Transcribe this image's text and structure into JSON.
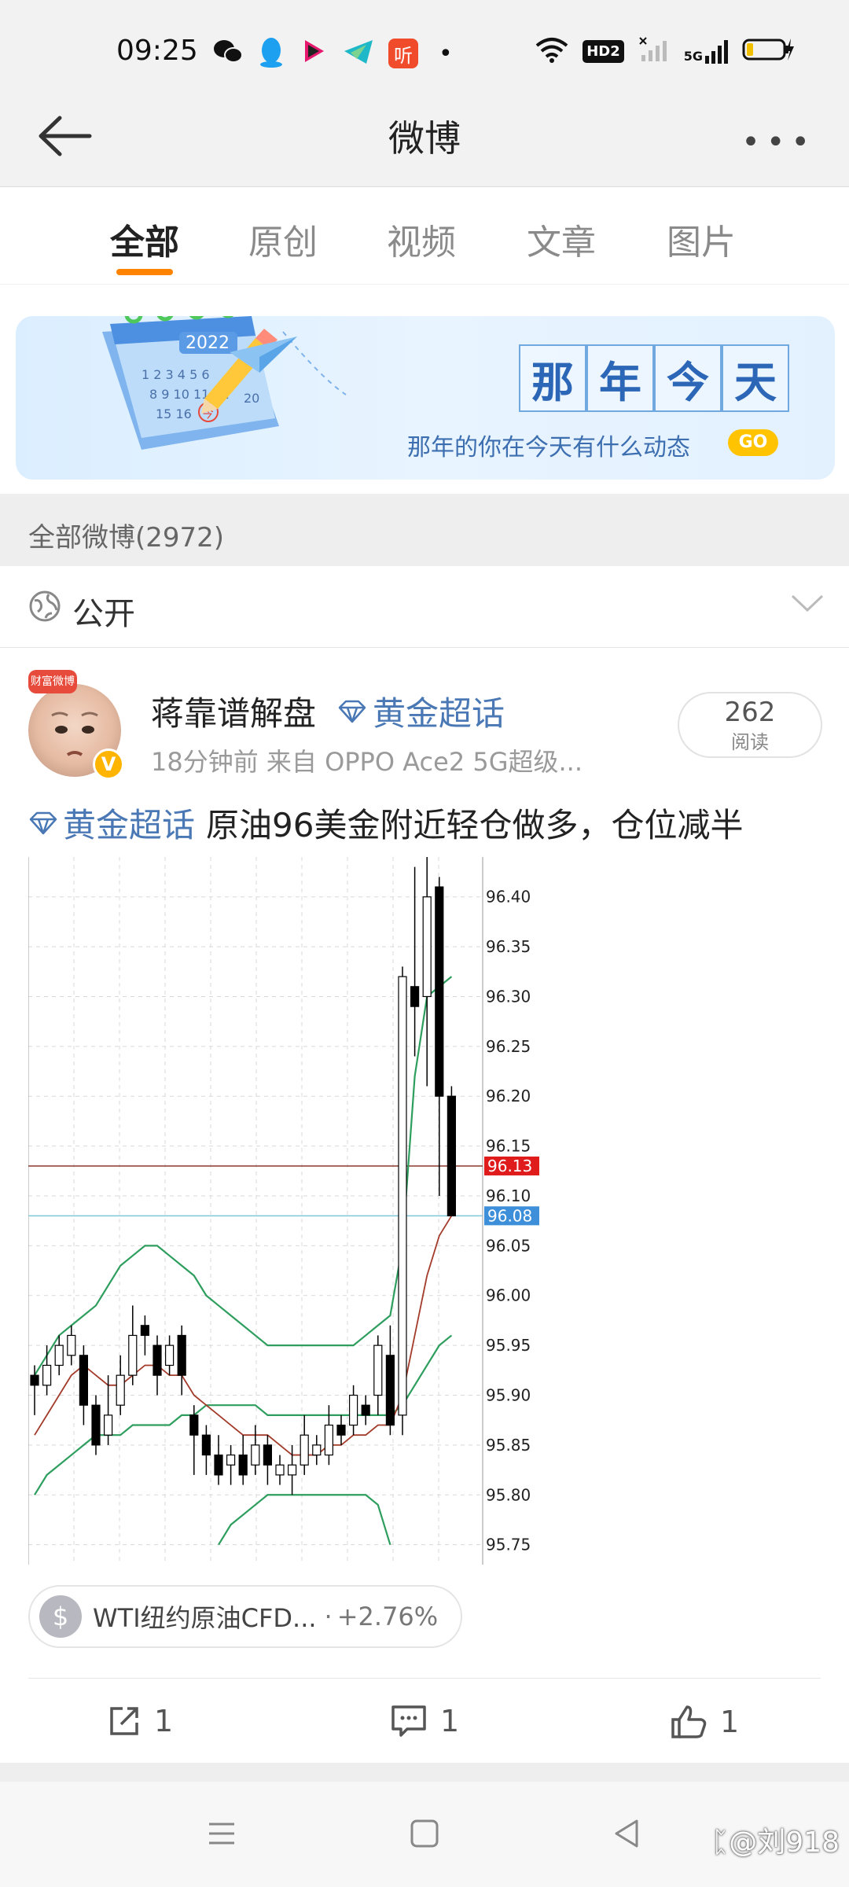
{
  "status_bar": {
    "time": "09:25",
    "app_icons": [
      "wechat-icon",
      "qq-icon",
      "tiktok-like-icon",
      "telegram-like-icon",
      "ting-icon"
    ],
    "ting_label": "听",
    "hd_label": "HD2",
    "network_label": "5G",
    "colors": {
      "qq": "#1ea0f0",
      "ting": "#f04b2b"
    }
  },
  "header": {
    "title": "微博",
    "back_icon": "back-arrow-icon",
    "more_icon": "more-dots-icon"
  },
  "tabs": [
    {
      "label": "全部",
      "active": true
    },
    {
      "label": "原创",
      "active": false
    },
    {
      "label": "视频",
      "active": false
    },
    {
      "label": "文章",
      "active": false
    },
    {
      "label": "图片",
      "active": false
    }
  ],
  "banner": {
    "calendar_year": "2022",
    "calendar_day_mark": "今",
    "chars": [
      "那",
      "年",
      "今",
      "天"
    ],
    "subtitle": "那年的你在今天有什么动态",
    "go_label": "GO"
  },
  "section": {
    "label": "全部微博(2972)"
  },
  "filter": {
    "label": "公开",
    "icon": "globe-icon"
  },
  "post": {
    "user_name": "蒋靠谱解盘",
    "avatar_badge": "财富微博",
    "verified_mark": "V",
    "topic_badge": "黄金超话",
    "meta": "18分钟前   来自 OPPO Ace2 5G超级...",
    "reads_count": "262",
    "reads_label": "阅读",
    "hash_topic": "黄金超话",
    "text": "原油96美金附近轻仓做多，仓位减半",
    "stock": {
      "name": "WTI纽约原油CFD...",
      "sep": "·",
      "change": "+2.76%",
      "dollar": "$"
    },
    "actions": {
      "repost": "1",
      "comment": "1",
      "like": "1"
    }
  },
  "chart_data": {
    "type": "candlestick",
    "ylim": [
      95.73,
      96.44
    ],
    "y_ticks": [
      "96.40",
      "96.35",
      "96.30",
      "96.25",
      "96.20",
      "96.15",
      "96.10",
      "96.05",
      "96.00",
      "95.95",
      "95.90",
      "95.85",
      "95.80",
      "95.75"
    ],
    "price_tags": [
      {
        "value": 96.13,
        "label": "96.13",
        "color": "#e01b1b",
        "line_color": "#8b3a2a"
      },
      {
        "value": 96.08,
        "label": "96.08",
        "color": "#3c8fd8",
        "line_color": "#7ec8d8"
      }
    ],
    "candles": [
      [
        95.92,
        95.91,
        95.93,
        95.88
      ],
      [
        95.91,
        95.93,
        95.95,
        95.9
      ],
      [
        95.93,
        95.95,
        95.96,
        95.92
      ],
      [
        95.94,
        95.96,
        95.97,
        95.93
      ],
      [
        95.94,
        95.89,
        95.95,
        95.87
      ],
      [
        95.89,
        95.85,
        95.9,
        95.84
      ],
      [
        95.86,
        95.88,
        95.92,
        95.85
      ],
      [
        95.89,
        95.92,
        95.94,
        95.88
      ],
      [
        95.92,
        95.96,
        95.99,
        95.91
      ],
      [
        95.97,
        95.96,
        95.98,
        95.94
      ],
      [
        95.95,
        95.92,
        95.96,
        95.9
      ],
      [
        95.93,
        95.95,
        95.96,
        95.92
      ],
      [
        95.96,
        95.92,
        95.97,
        95.9
      ],
      [
        95.88,
        95.86,
        95.89,
        95.82
      ],
      [
        95.86,
        95.84,
        95.87,
        95.82
      ],
      [
        95.84,
        95.82,
        95.86,
        95.81
      ],
      [
        95.83,
        95.84,
        95.85,
        95.81
      ],
      [
        95.84,
        95.82,
        95.86,
        95.81
      ],
      [
        95.83,
        95.85,
        95.87,
        95.82
      ],
      [
        95.85,
        95.83,
        95.86,
        95.81
      ],
      [
        95.82,
        95.83,
        95.84,
        95.81
      ],
      [
        95.82,
        95.83,
        95.85,
        95.8
      ],
      [
        95.83,
        95.86,
        95.88,
        95.82
      ],
      [
        95.84,
        95.85,
        95.86,
        95.83
      ],
      [
        95.84,
        95.87,
        95.89,
        95.83
      ],
      [
        95.87,
        95.86,
        95.88,
        95.85
      ],
      [
        95.87,
        95.9,
        95.91,
        95.86
      ],
      [
        95.89,
        95.88,
        95.9,
        95.87
      ],
      [
        95.9,
        95.95,
        95.96,
        95.88
      ],
      [
        95.94,
        95.87,
        95.97,
        95.86
      ],
      [
        95.88,
        96.32,
        96.33,
        95.86
      ],
      [
        96.31,
        96.29,
        96.43,
        96.24
      ],
      [
        96.3,
        96.4,
        96.44,
        96.21
      ],
      [
        96.41,
        96.2,
        96.42,
        96.1
      ],
      [
        96.2,
        96.08,
        96.21,
        96.08
      ]
    ],
    "ma_red": [
      95.86,
      95.88,
      95.9,
      95.92,
      95.93,
      95.92,
      95.91,
      95.91,
      95.92,
      95.93,
      95.93,
      95.92,
      95.92,
      95.9,
      95.89,
      95.88,
      95.87,
      95.86,
      95.86,
      95.86,
      95.85,
      95.84,
      95.84,
      95.84,
      95.85,
      95.85,
      95.86,
      95.86,
      95.87,
      95.87,
      95.9,
      95.96,
      96.02,
      96.06,
      96.08
    ],
    "bb_upper": [
      95.92,
      95.94,
      95.96,
      95.97,
      95.98,
      95.99,
      96.01,
      96.03,
      96.04,
      96.05,
      96.05,
      96.04,
      96.03,
      96.02,
      96.0,
      95.99,
      95.98,
      95.97,
      95.96,
      95.95,
      95.95,
      95.95,
      95.95,
      95.95,
      95.95,
      95.95,
      95.95,
      95.96,
      95.97,
      95.98,
      96.05,
      96.22,
      96.3,
      96.31,
      96.32
    ],
    "bb_middle": [
      95.8,
      95.82,
      95.83,
      95.84,
      95.85,
      95.86,
      95.86,
      95.86,
      95.87,
      95.87,
      95.87,
      95.87,
      95.88,
      95.88,
      95.89,
      95.89,
      95.89,
      95.89,
      95.89,
      95.88,
      95.88,
      95.88,
      95.88,
      95.88,
      95.88,
      95.88,
      95.88,
      95.88,
      95.88,
      95.88,
      95.89,
      95.91,
      95.93,
      95.95,
      95.96
    ],
    "bb_lower": [
      null,
      null,
      null,
      null,
      null,
      null,
      null,
      null,
      null,
      null,
      null,
      null,
      null,
      null,
      null,
      95.75,
      95.77,
      95.78,
      95.79,
      95.8,
      95.8,
      95.8,
      95.8,
      95.8,
      95.8,
      95.8,
      95.8,
      95.8,
      95.79,
      95.75,
      null,
      null,
      null,
      null,
      null
    ],
    "colors": {
      "up_body": "#ffffff",
      "down_body": "#000000",
      "wick": "#000000",
      "ma_red": "#a33b2b",
      "bb": "#2e9e5e",
      "grid": "#d9d9d9"
    }
  }
}
